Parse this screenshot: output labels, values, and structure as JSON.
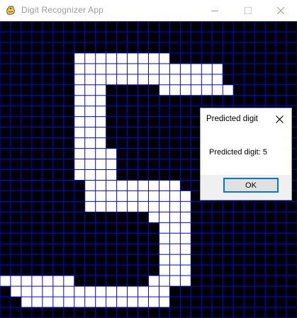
{
  "window": {
    "title": "Digit Recognizer App",
    "icon": "pygame-snake-icon",
    "controls": [
      "minimize-icon",
      "maximize-icon",
      "close-icon"
    ]
  },
  "canvas": {
    "background": "#000000",
    "grid_color": "#0000ff",
    "fill_color": "#ffffff",
    "columns": 28,
    "rows": 28,
    "pixels": [
      "............................",
      "............................",
      "............................",
      ".......#########............",
      ".......##############.......",
      ".......##############.......",
      ".......###.....#######......",
      ".......###..................",
      ".......###..................",
      ".......###..................",
      ".......###..................",
      ".......###..................",
      ".......####.................",
      ".......####.................",
      ".......####.................",
      "........#########...........",
      "........##########..........",
      "........##########..........",
      "..............####..........",
      "...............###..........",
      "...............###..........",
      "...............###..........",
      "...............###..........",
      "...............###..........",
      "#######.......####..........",
      ".###############...........",
      "..##############..........."
    ]
  },
  "dialog": {
    "title": "Predicted digit",
    "message": "Predicted digit: 5",
    "ok_label": "OK",
    "close_icon": "close-icon"
  }
}
